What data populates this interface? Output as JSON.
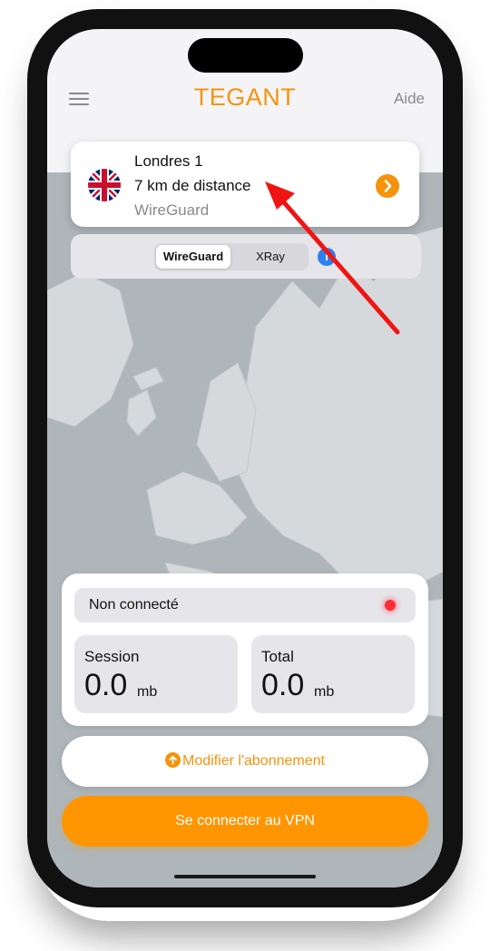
{
  "app": {
    "title": "TEGANT",
    "help_label": "Aide"
  },
  "server": {
    "name": "Londres 1",
    "distance": "7 km de distance",
    "protocol": "WireGuard"
  },
  "protocol_selector": {
    "options": [
      "WireGuard",
      "XRay"
    ],
    "selected": "WireGuard",
    "info_glyph": "i"
  },
  "status": {
    "text": "Non connecté",
    "color": "#ff2d3a"
  },
  "stats": {
    "session": {
      "label": "Session",
      "value": "0.0",
      "unit": "mb"
    },
    "total": {
      "label": "Total",
      "value": "0.0",
      "unit": "mb"
    }
  },
  "buttons": {
    "subscription": "Modifier l'abonnement",
    "connect": "Se connecter au VPN"
  },
  "colors": {
    "accent": "#ff9500",
    "annotation_arrow": "#f01414"
  }
}
